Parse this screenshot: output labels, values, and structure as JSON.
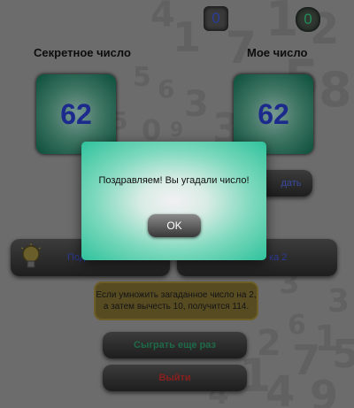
{
  "counters": {
    "attempts": "0",
    "score": "0"
  },
  "secret": {
    "label": "Секретное число",
    "value": "62"
  },
  "mine": {
    "label": "Мое число",
    "value": "62"
  },
  "buttons": {
    "guess": "дать",
    "hint1": "Под",
    "hint2": "ка 2",
    "play_again": "Сыграть еще раз",
    "exit": "Выйти"
  },
  "hint_text": {
    "line1": "Если умножить загаданное число на 2,",
    "line2": "а затем вычесть 10, получится 114."
  },
  "dialog": {
    "message": "Поздравляем! Вы угадали число!",
    "ok": "OK"
  }
}
